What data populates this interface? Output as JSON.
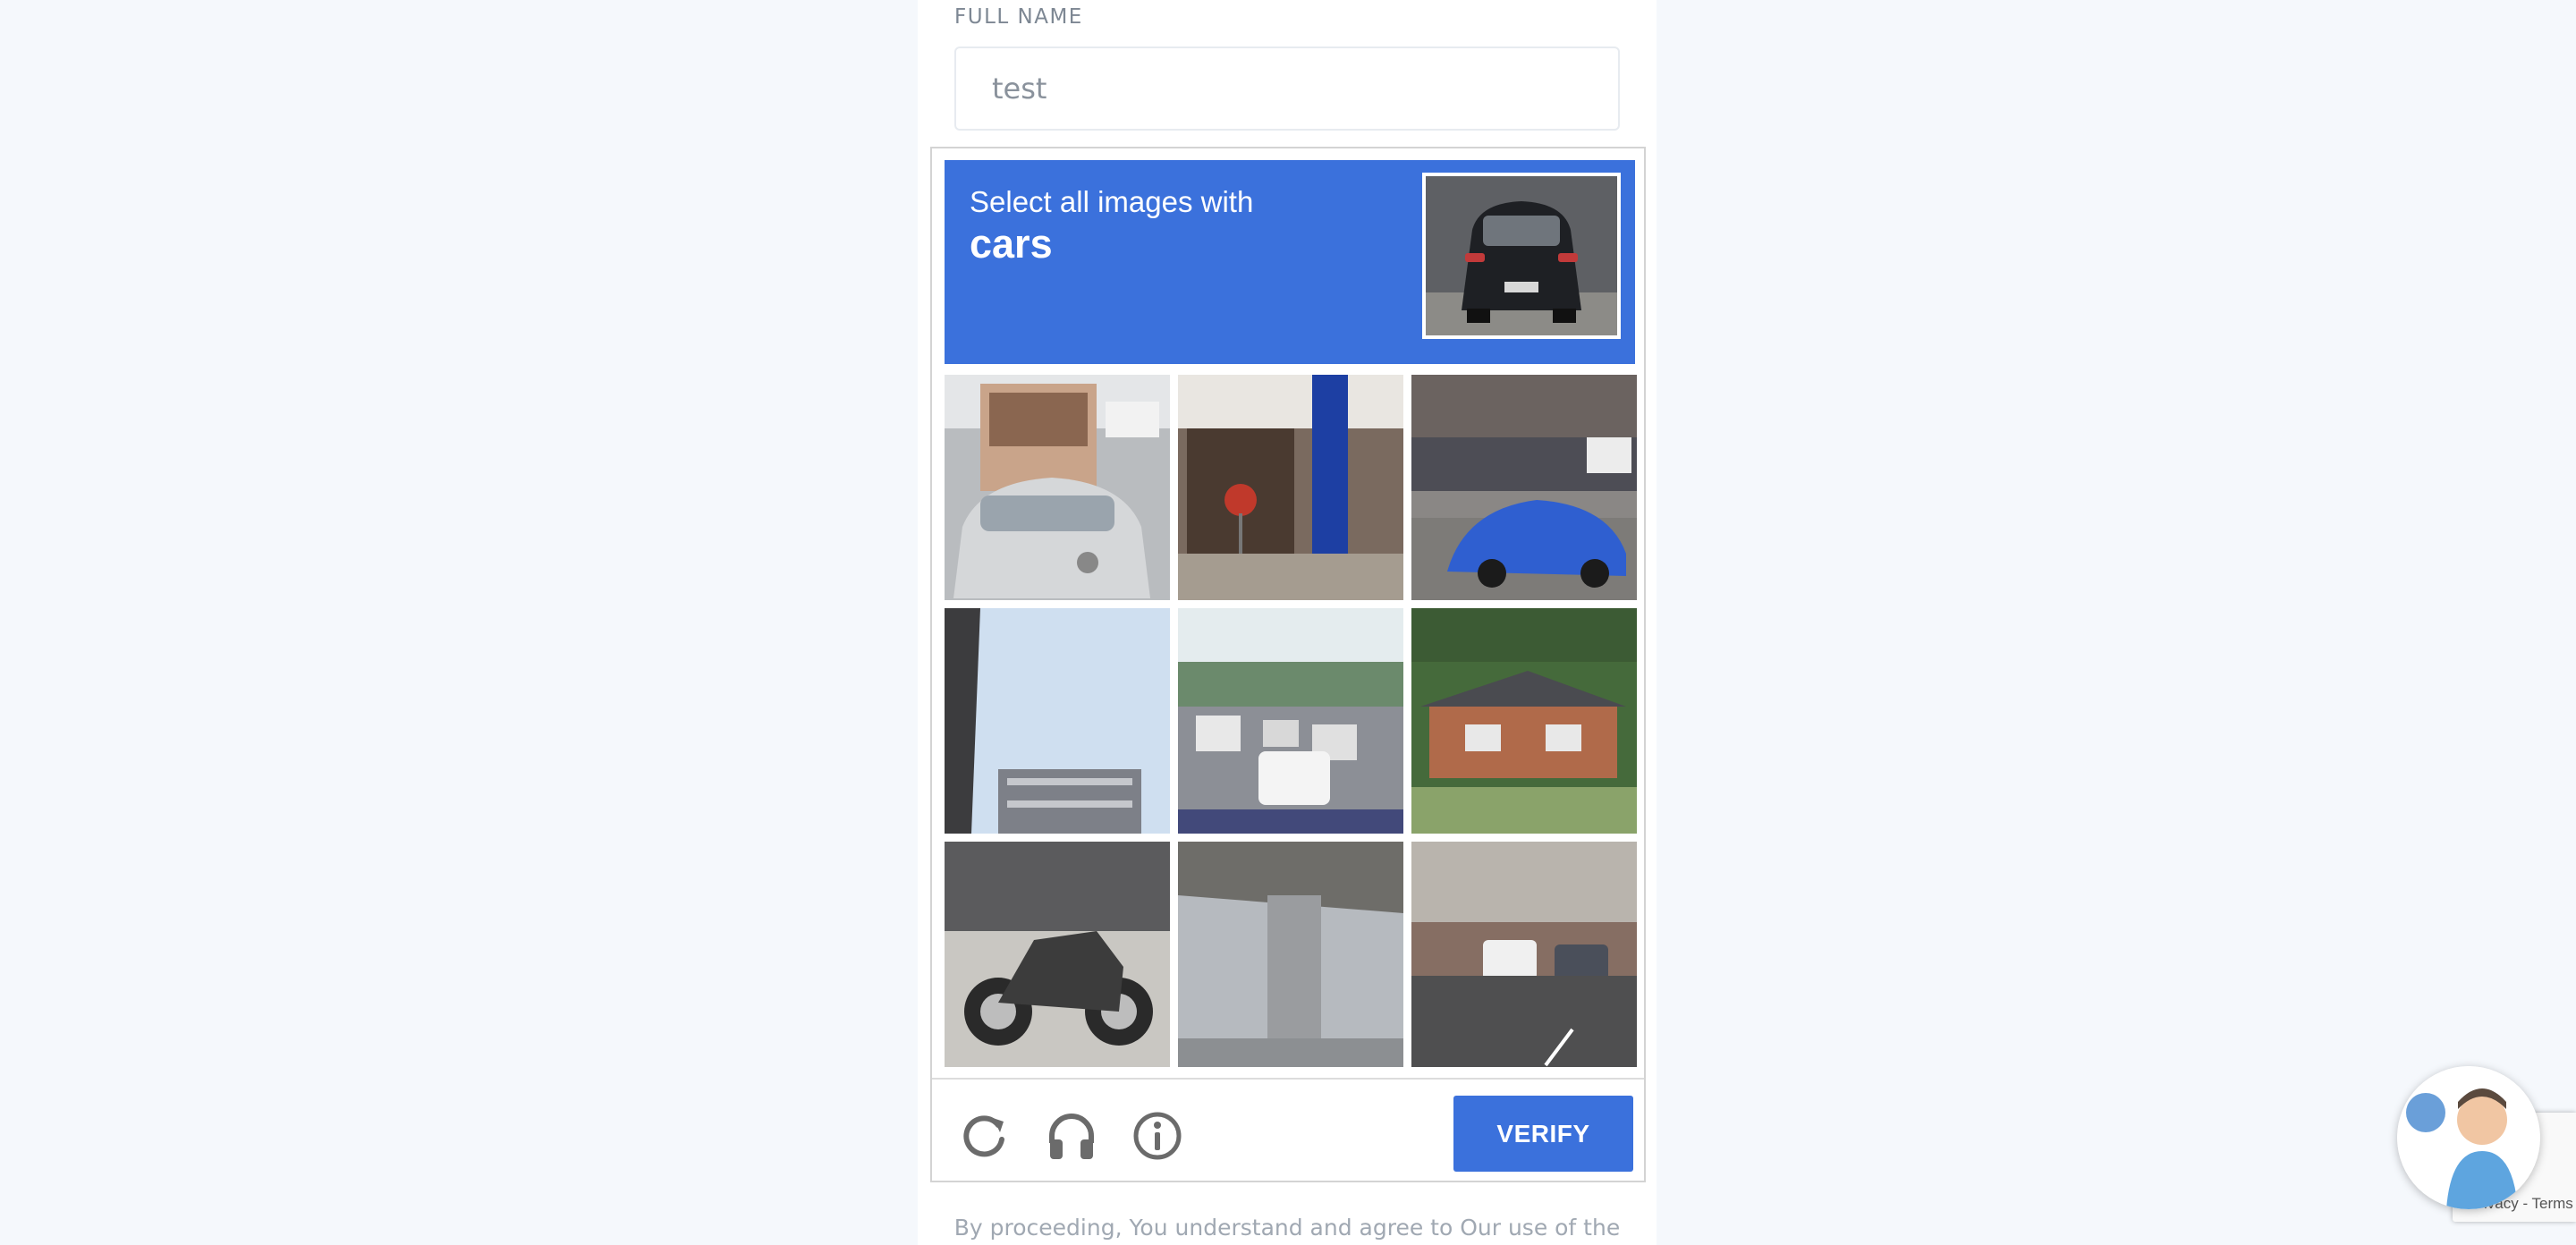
{
  "form": {
    "full_name_label": "FULL NAME",
    "full_name_value": "test"
  },
  "captcha": {
    "prompt_line1": "Select all images with",
    "prompt_target": "cars",
    "accent_color": "#3b71dc",
    "tiles": [
      {
        "content": "truck and silver sedan on highway"
      },
      {
        "content": "storefront with stop sign"
      },
      {
        "content": "blue sports car on street"
      },
      {
        "content": "apartment building and sky"
      },
      {
        "content": "traffic jam on road"
      },
      {
        "content": "brick house with lawn"
      },
      {
        "content": "motorcycle parked"
      },
      {
        "content": "highway overpass pillar"
      },
      {
        "content": "cars parked on street"
      }
    ],
    "icons": [
      "reload-icon",
      "audio-headphones-icon",
      "info-icon"
    ],
    "verify_label": "VERIFY"
  },
  "footer": {
    "disclaimer": "By proceeding, You understand and agree to Our use of the"
  },
  "recaptcha_badge": {
    "terms_text": "Privacy - Terms"
  }
}
